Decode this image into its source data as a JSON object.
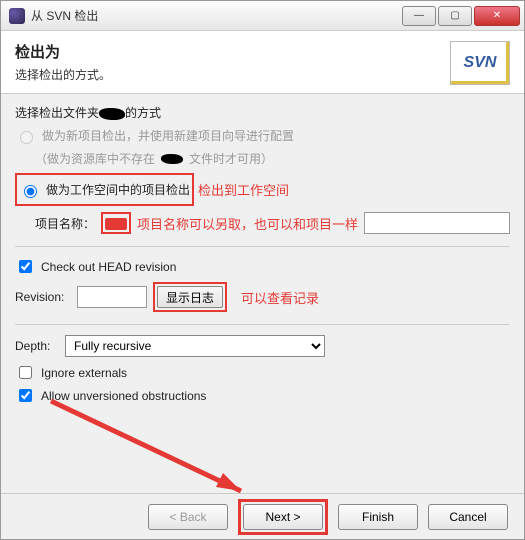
{
  "title": "从 SVN 检出",
  "header": {
    "title": "检出为",
    "subtitle": "选择检出的方式。"
  },
  "logo": "SVN",
  "section1": {
    "label_prefix": "选择检出文件夹",
    "label_suffix": "的方式",
    "radio1": "做为新项目检出，并使用新建项目向导进行配置",
    "radio2_prefix": "（做为资源库中不存在",
    "radio2_suffix": "文件时才可用）",
    "radio3": "做为工作空间中的项目检出",
    "annot1": "检出到工作空间",
    "projname_label": "项目名称：",
    "annot2": "项目名称可以另取，也可以和项目一样"
  },
  "section2": {
    "chk_head": "Check out HEAD revision",
    "rev_label": "Revision:",
    "rev_value": "",
    "show_log": "显示日志",
    "annot3": "可以查看记录"
  },
  "section3": {
    "depth_label": "Depth:",
    "depth_value": "Fully recursive",
    "chk_ignore": "Ignore externals",
    "chk_unver": "Allow unversioned obstructions"
  },
  "footer": {
    "back": "< Back",
    "next": "Next >",
    "finish": "Finish",
    "cancel": "Cancel"
  }
}
